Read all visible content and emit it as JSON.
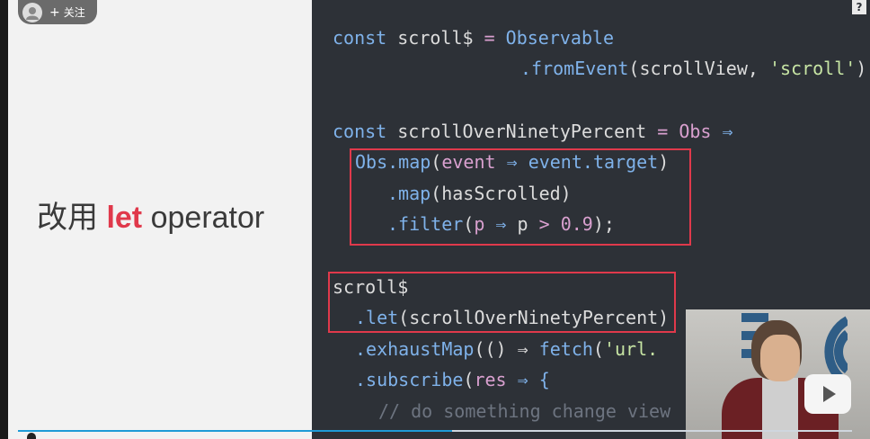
{
  "follow": {
    "plus": "+",
    "label": "关注"
  },
  "help": {
    "label": "?"
  },
  "slide": {
    "heading_prefix": "改用 ",
    "heading_keyword": "let",
    "heading_suffix": " operator"
  },
  "code": {
    "l1": {
      "a": "const ",
      "b": "scroll$",
      "c": " = ",
      "d": "Observable"
    },
    "l2": {
      "a": ".fromEvent",
      "b": "(scrollView, ",
      "c": "'scroll'",
      "d": ")"
    },
    "l3": {
      "a": "const ",
      "b": "scrollOverNinetyPercent",
      "c": " = ",
      "d": "Obs",
      "e": " ⇒"
    },
    "l4": {
      "a": "Obs",
      "b": ".map",
      "c": "(",
      "d": "event",
      "e": " ⇒ ",
      "f": "event",
      "g": ".target",
      "h": ")"
    },
    "l5": {
      "a": ".map",
      "b": "(hasScrolled)"
    },
    "l6": {
      "a": ".filter",
      "b": "(",
      "c": "p",
      "d": " ⇒ ",
      "e": "p",
      "f": " > ",
      "g": "0.9",
      "h": ");"
    },
    "l7": {
      "a": "scroll$"
    },
    "l8": {
      "a": ".let",
      "b": "(scrollOverNinetyPercent)"
    },
    "l9": {
      "a": ".exhaustMap",
      "b": "(() ⇒ ",
      "c": "fetch",
      "d": "(",
      "e": "'url."
    },
    "l10": {
      "a": ".subscribe",
      "b": "(",
      "c": "res",
      "d": " ⇒ {"
    },
    "l11": {
      "a": "// do something change view"
    }
  },
  "player": {
    "progress": 0.52
  },
  "colors": {
    "accent": "#e0394b",
    "progress": "#1e9bd7",
    "code_bg": "#2d3137"
  }
}
